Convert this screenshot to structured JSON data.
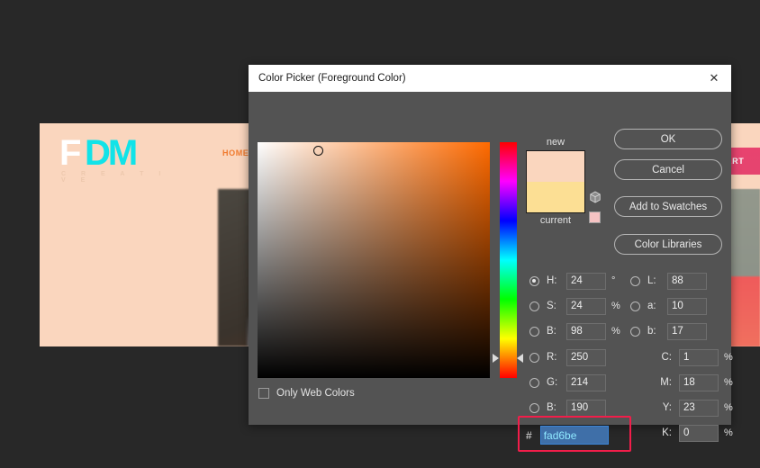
{
  "background_page": {
    "logo": {
      "part1": "F",
      "part2": "DM",
      "subtitle": "C R E A T I V E"
    },
    "nav": {
      "home": "HOME"
    },
    "cta": {
      "start": "START"
    }
  },
  "dialog": {
    "title": "Color Picker (Foreground Color)",
    "close_icon": "✕",
    "preview": {
      "new_label": "new",
      "current_label": "current",
      "new_color": "#fad6be",
      "current_color": "#fcdf94",
      "web_safe_color": "#f6c3c3"
    },
    "buttons": {
      "ok": "OK",
      "cancel": "Cancel",
      "add_to_swatches": "Add to Swatches",
      "color_libraries": "Color Libraries"
    },
    "web_colors": {
      "label": "Only Web Colors",
      "checked": false
    },
    "hsb": [
      {
        "label": "H:",
        "value": "24",
        "unit": "°",
        "selected": true
      },
      {
        "label": "S:",
        "value": "24",
        "unit": "%",
        "selected": false
      },
      {
        "label": "B:",
        "value": "98",
        "unit": "%",
        "selected": false
      }
    ],
    "lab": [
      {
        "label": "L:",
        "value": "88",
        "unit": "",
        "selected": false
      },
      {
        "label": "a:",
        "value": "10",
        "unit": "",
        "selected": false
      },
      {
        "label": "b:",
        "value": "17",
        "unit": "",
        "selected": false
      }
    ],
    "rgb": [
      {
        "label": "R:",
        "value": "250",
        "unit": "",
        "selected": false
      },
      {
        "label": "G:",
        "value": "214",
        "unit": "",
        "selected": false
      },
      {
        "label": "B:",
        "value": "190",
        "unit": "",
        "selected": false
      }
    ],
    "cmyk": [
      {
        "label": "C:",
        "value": "1",
        "unit": "%"
      },
      {
        "label": "M:",
        "value": "18",
        "unit": "%"
      },
      {
        "label": "Y:",
        "value": "23",
        "unit": "%"
      },
      {
        "label": "K:",
        "value": "0",
        "unit": "%"
      }
    ],
    "hex": {
      "hash": "#",
      "value": "fad6be"
    },
    "accent_highlight": "#f21d4a"
  }
}
